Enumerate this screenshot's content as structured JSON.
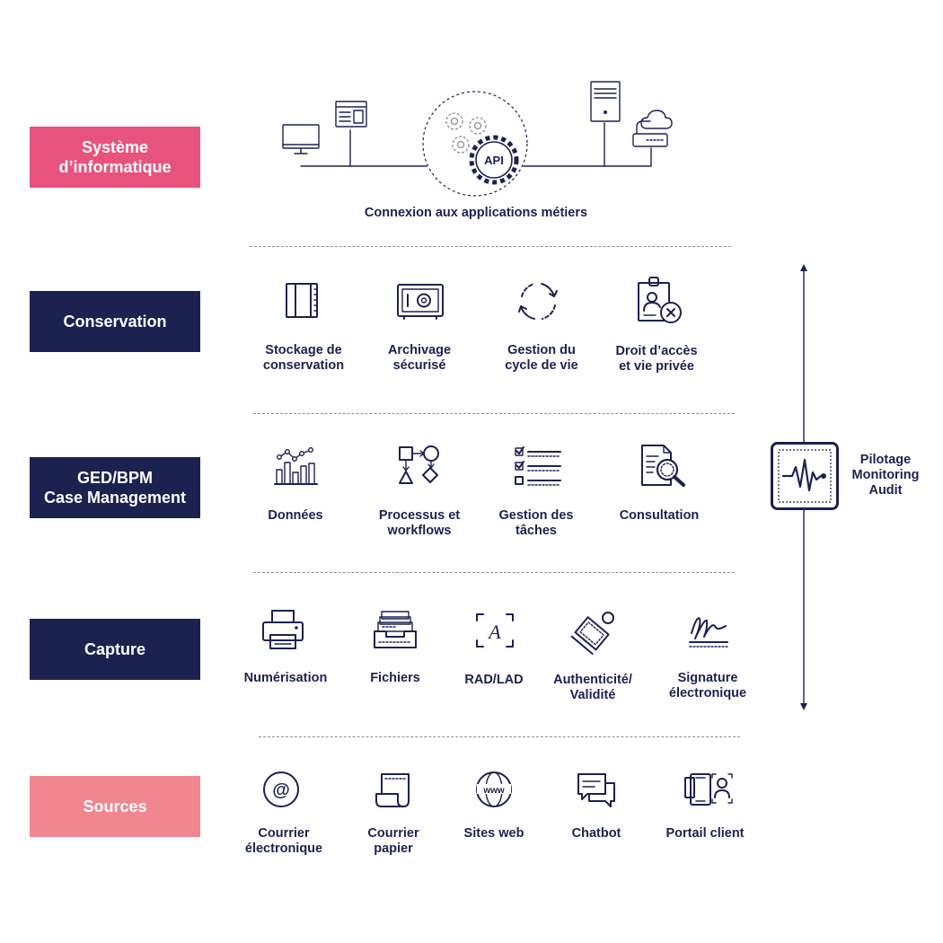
{
  "colors": {
    "navy": "#1c2250",
    "pink": "#e8537e",
    "light_pink": "#f0868f",
    "divider": "#8a8d9f"
  },
  "layers": {
    "systeme": "Système\nd’informatique",
    "conservation": "Conservation",
    "ged": "GED/BPM\nCase Management",
    "capture": "Capture",
    "sources": "Sources"
  },
  "systeme_caption": "Connexion aux applications métiers",
  "api_label": "API",
  "conservation_items": [
    {
      "label": "Stockage de\nconservation",
      "icon": "binder-icon"
    },
    {
      "label": "Archivage\nsécurisé",
      "icon": "safe-icon"
    },
    {
      "label": "Gestion du\ncycle de vie",
      "icon": "cycle-icon"
    },
    {
      "label": "Droit d’accès\net vie privée",
      "icon": "access-badge-icon"
    }
  ],
  "ged_items": [
    {
      "label": "Données",
      "icon": "bar-chart-icon"
    },
    {
      "label": "Processus et\nworkflows",
      "icon": "workflow-icon"
    },
    {
      "label": "Gestion des\ntâches",
      "icon": "checklist-icon"
    },
    {
      "label": "Consultation",
      "icon": "document-search-icon"
    }
  ],
  "capture_items": [
    {
      "label": "Numérisation",
      "icon": "printer-icon"
    },
    {
      "label": "Fichiers",
      "icon": "file-tray-icon"
    },
    {
      "label": "RAD/LAD",
      "icon": "ocr-icon"
    },
    {
      "label": "Authenticité/\nValidité",
      "icon": "stamp-icon"
    },
    {
      "label": "Signature\nélectronique",
      "icon": "signature-icon"
    }
  ],
  "sources_items": [
    {
      "label": "Courrier\nélectronique",
      "icon": "at-sign-icon"
    },
    {
      "label": "Courrier\npapier",
      "icon": "paper-scroll-icon"
    },
    {
      "label": "Sites web",
      "icon": "globe-icon"
    },
    {
      "label": "Chatbot",
      "icon": "chat-icon"
    },
    {
      "label": "Portail client",
      "icon": "devices-icon"
    }
  ],
  "monitoring": {
    "label": "Pilotage\nMonitoring\nAudit",
    "icon": "pulse-monitor-icon"
  }
}
